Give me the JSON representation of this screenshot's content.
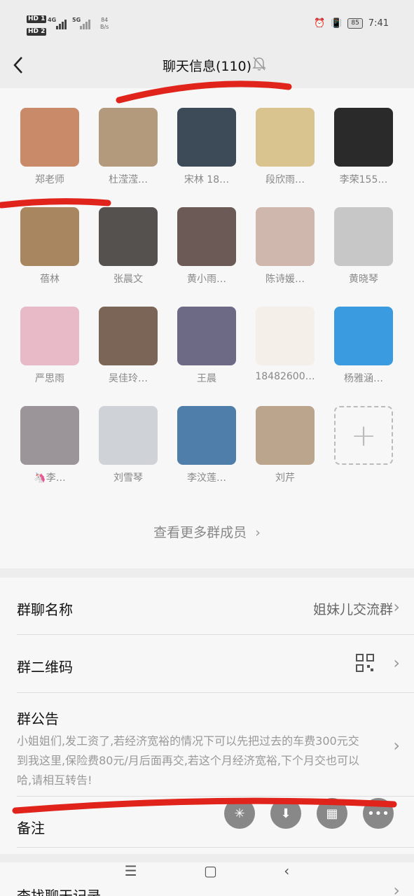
{
  "status_bar": {
    "hd1": "HD 1",
    "hd2": "HD 2",
    "net1": "4G",
    "net2": "5G",
    "speed_value": "84",
    "speed_unit": "B/s",
    "battery": "85",
    "time": "7:41"
  },
  "header": {
    "title": "聊天信息(110)"
  },
  "members": [
    {
      "name": "郑老师",
      "color": "#c98a6a"
    },
    {
      "name": "杜滢滢…",
      "color": "#b39a7c"
    },
    {
      "name": "宋林 18…",
      "color": "#3d4a57"
    },
    {
      "name": "段欣雨…",
      "color": "#d9c38e"
    },
    {
      "name": "李荣155…",
      "color": "#2a2a2a"
    },
    {
      "name": "蓓林",
      "color": "#a88660"
    },
    {
      "name": "张晨文",
      "color": "#55514e"
    },
    {
      "name": "黄小雨…",
      "color": "#6b5a56"
    },
    {
      "name": "陈诗媛…",
      "color": "#cfb7ad"
    },
    {
      "name": "黄晓琴",
      "color": "#c7c7c7"
    },
    {
      "name": "严思雨",
      "color": "#e8b9c7"
    },
    {
      "name": "吴佳玲…",
      "color": "#7a6556"
    },
    {
      "name": "王晨",
      "color": "#6d6a86"
    },
    {
      "name": "18482600…",
      "color": "#f4efe8"
    },
    {
      "name": "杨雅涵…",
      "color": "#3b9be0"
    },
    {
      "name": "🦄李…",
      "color": "#9b9499"
    },
    {
      "name": "刘雪琴",
      "color": "#cfd2d6"
    },
    {
      "name": "李汶莲…",
      "color": "#4f7eaa"
    },
    {
      "name": "刘芹",
      "color": "#bca58d"
    }
  ],
  "more_members": "查看更多群成员",
  "settings": {
    "group_name_label": "群聊名称",
    "group_name_value": "姐妹儿交流群",
    "qr_label": "群二维码",
    "notice_label": "群公告",
    "notice_text": "小姐姐们,发工资了,若经济宽裕的情况下可以先把过去的车费300元交到我这里,保险费80元/月后面再交,若这个月经济宽裕,下个月交也可以哈,请相互转告!",
    "remark_label": "备注",
    "search_label": "查找聊天记录"
  },
  "colors": {
    "annotation_red": "#e0241b"
  }
}
